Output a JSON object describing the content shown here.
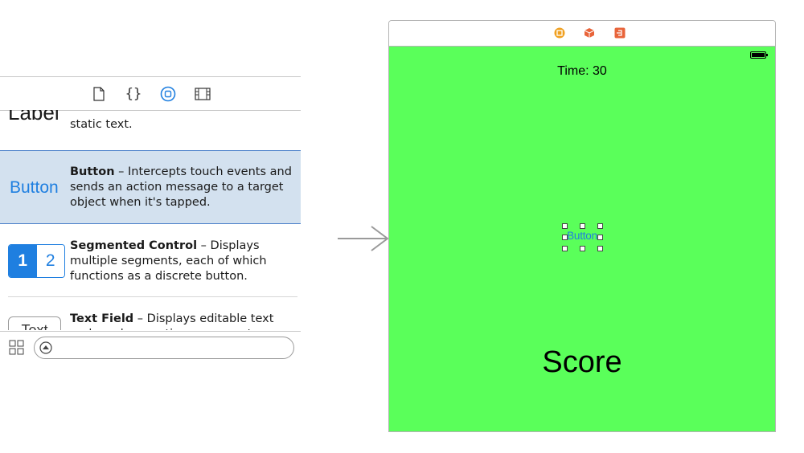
{
  "library": {
    "tabs": [
      {
        "name": "file-template-tab",
        "icon": "document-icon",
        "active": false
      },
      {
        "name": "code-snippet-tab",
        "icon": "braces-icon",
        "active": false
      },
      {
        "name": "object-library-tab",
        "icon": "object-library-icon",
        "active": true
      },
      {
        "name": "media-library-tab",
        "icon": "film-strip-icon",
        "active": false
      }
    ],
    "items": [
      {
        "thumb": "Label",
        "name": "",
        "desc": "static text."
      },
      {
        "thumb": "Button",
        "name": "Button",
        "desc": " – Intercepts touch events and sends an action message to a target object when it's tapped.",
        "selected": true
      },
      {
        "thumb_segments": [
          "1",
          "2"
        ],
        "name": "Segmented Control",
        "desc": " – Displays multiple segments, each of which functions as a discrete button."
      },
      {
        "thumb": "Text",
        "name": "Text Field",
        "desc": " – Displays editable text and sends an action message to a target"
      }
    ],
    "filter": {
      "placeholder": "",
      "value": ""
    }
  },
  "scene": {
    "time_label": "Time: 30",
    "button_label": "Button",
    "score_label": "Score",
    "colors": {
      "background": "#5aff5a",
      "button_text": "#1f7fe0"
    },
    "dock_icons": [
      "view-controller-icon",
      "first-responder-icon",
      "exit-icon"
    ]
  }
}
